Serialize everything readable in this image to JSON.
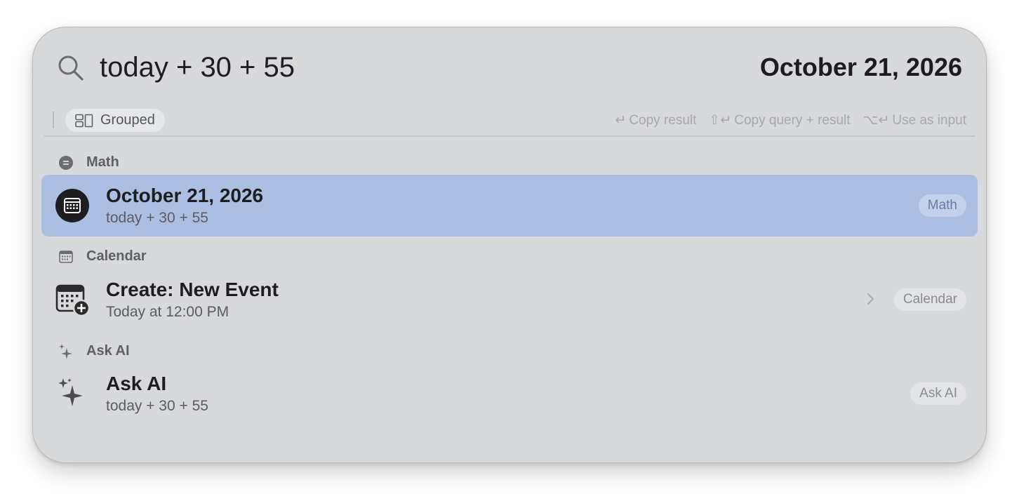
{
  "search": {
    "query": "today + 30 + 55",
    "result_preview": "October 21, 2026"
  },
  "toolbar": {
    "grouped_label": "Grouped",
    "shortcuts": [
      {
        "symbol": "↵",
        "label": "Copy result"
      },
      {
        "symbol": "⇧↵",
        "label": "Copy query + result"
      },
      {
        "symbol": "⌥↵",
        "label": "Use as input"
      }
    ]
  },
  "sections": [
    {
      "header": "Math",
      "header_icon": "equals-circle-icon",
      "items": [
        {
          "title": "October 21, 2026",
          "subtitle": "today + 30 + 55",
          "tag": "Math",
          "icon": "calendar-grid-icon",
          "selected": true
        }
      ]
    },
    {
      "header": "Calendar",
      "header_icon": "calendar-icon",
      "items": [
        {
          "title": "Create: New Event",
          "subtitle": "Today at 12:00 PM",
          "tag": "Calendar",
          "icon": "calendar-add-icon",
          "selected": false
        }
      ]
    },
    {
      "header": "Ask AI",
      "header_icon": "sparkles-icon",
      "items": [
        {
          "title": "Ask AI",
          "subtitle": "today + 30 + 55",
          "tag": "Ask AI",
          "icon": "sparkles-icon",
          "selected": false
        }
      ]
    }
  ],
  "colors": {
    "panel_bg": "#d8d9db",
    "selected_row": "#abbfe3",
    "text_primary": "#1d1d20",
    "text_secondary": "#5b5c60"
  }
}
